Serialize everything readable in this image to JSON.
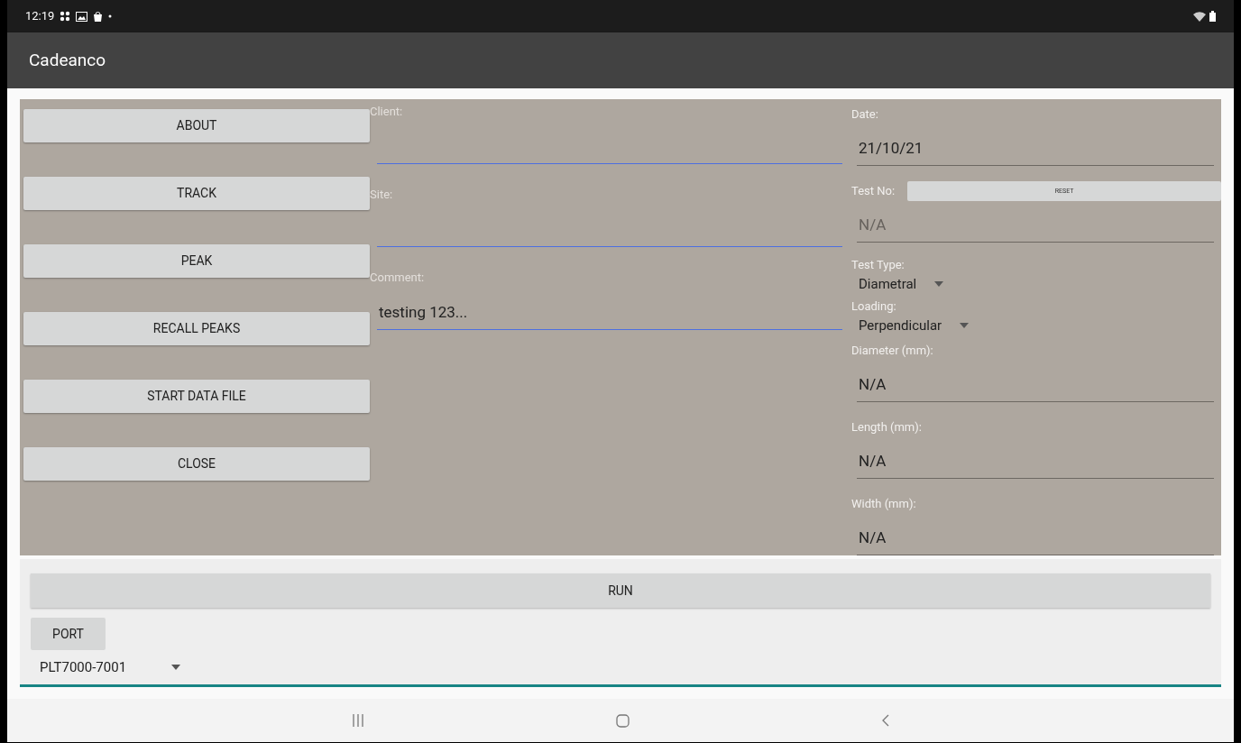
{
  "status_bar": {
    "time": "12:19"
  },
  "app_bar": {
    "title": "Cadeanco"
  },
  "menu_buttons": [
    "ABOUT",
    "TRACK",
    "PEAK",
    "RECALL PEAKS",
    "START DATA FILE",
    "CLOSE"
  ],
  "middle_fields": [
    {
      "label": "Client:"
    },
    {
      "label": "Site:"
    },
    {
      "label": "Comment:",
      "value": "testing 123..."
    }
  ],
  "right_fields": [
    {
      "kind": "text",
      "label": "Date:",
      "value": "21/10/21"
    },
    {
      "kind": "text",
      "label": "Test No:",
      "button": "RESET",
      "placeholder": "N/A"
    },
    {
      "kind": "dropdown",
      "label": "Test Type:",
      "value": "Diametral"
    },
    {
      "kind": "dropdown",
      "label": "Loading:",
      "value": "Perpendicular"
    },
    {
      "kind": "text",
      "label": "Diameter (mm):",
      "value": "N/A"
    },
    {
      "kind": "text",
      "label": "Length (mm):",
      "value": "N/A"
    },
    {
      "kind": "text",
      "label": "Width (mm):",
      "value": "N/A"
    }
  ],
  "run_button": "RUN",
  "port_button": "PORT",
  "port_dropdown": {
    "value": "PLT7000-7001"
  }
}
